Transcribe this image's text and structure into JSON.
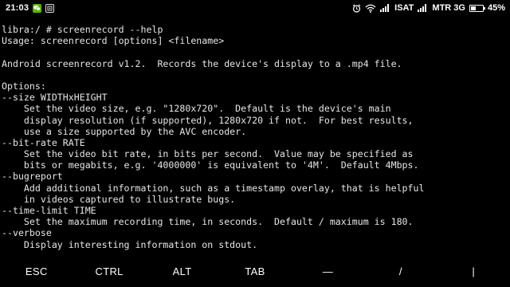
{
  "status_bar": {
    "time": "21:03",
    "notification_icons": [
      "wechat-icon",
      "ad-icon"
    ],
    "indicator_icons": [
      "alarm-icon",
      "wifi-icon",
      "signal-icon"
    ],
    "carrier1": "ISAT",
    "carrier2": "MTR 3G",
    "battery": "45%",
    "battery_level": 0.45
  },
  "terminal": {
    "lines": [
      "libra:/ # screenrecord --help",
      "Usage: screenrecord [options] <filename>",
      "",
      "Android screenrecord v1.2.  Records the device's display to a .mp4 file.",
      "",
      "Options:",
      "--size WIDTHxHEIGHT",
      "    Set the video size, e.g. \"1280x720\".  Default is the device's main",
      "    display resolution (if supported), 1280x720 if not.  For best results,",
      "    use a size supported by the AVC encoder.",
      "--bit-rate RATE",
      "    Set the video bit rate, in bits per second.  Value may be specified as",
      "    bits or megabits, e.g. '4000000' is equivalent to '4M'.  Default 4Mbps.",
      "--bugreport",
      "    Add additional information, such as a timestamp overlay, that is helpful",
      "    in videos captured to illustrate bugs.",
      "--time-limit TIME",
      "    Set the maximum recording time, in seconds.  Default / maximum is 180.",
      "--verbose",
      "    Display interesting information on stdout."
    ]
  },
  "extra_keys": [
    {
      "name": "esc-key",
      "label": "ESC"
    },
    {
      "name": "ctrl-key",
      "label": "CTRL"
    },
    {
      "name": "alt-key",
      "label": "ALT"
    },
    {
      "name": "tab-key",
      "label": "TAB"
    },
    {
      "name": "dash-key",
      "label": "—"
    },
    {
      "name": "slash-key",
      "label": "/"
    },
    {
      "name": "pipe-key",
      "label": "|"
    }
  ]
}
